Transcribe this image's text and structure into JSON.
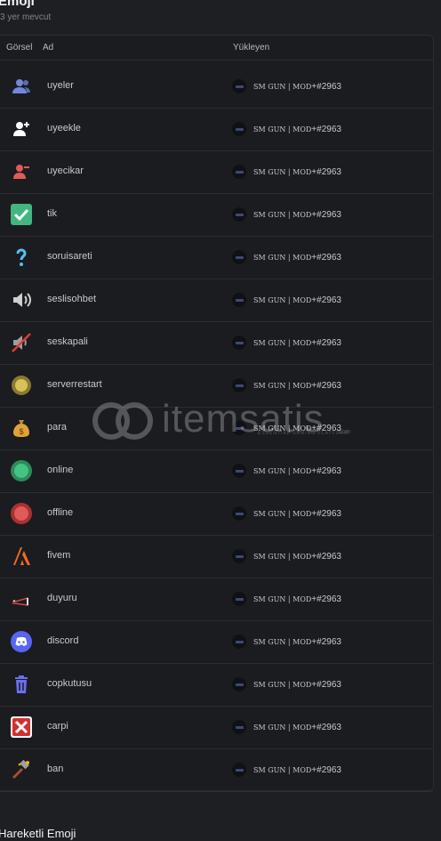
{
  "section": {
    "title": "Emoji",
    "subtitle": "3 yer mevcut"
  },
  "table": {
    "headers": {
      "image": "Görsel",
      "name": "Ad",
      "uploader": "Yükleyen"
    },
    "rows": [
      {
        "name": "uyeler",
        "icon": "users-icon"
      },
      {
        "name": "uyeekle",
        "icon": "user-add-icon"
      },
      {
        "name": "uyecikar",
        "icon": "user-remove-icon"
      },
      {
        "name": "tik",
        "icon": "check-icon"
      },
      {
        "name": "soruisareti",
        "icon": "question-icon"
      },
      {
        "name": "seslisohbet",
        "icon": "speaker-icon"
      },
      {
        "name": "seskapali",
        "icon": "speaker-muted-icon"
      },
      {
        "name": "serverrestart",
        "icon": "yellow-circle-icon"
      },
      {
        "name": "para",
        "icon": "money-bag-icon"
      },
      {
        "name": "online",
        "icon": "green-circle-icon"
      },
      {
        "name": "offline",
        "icon": "red-circle-icon"
      },
      {
        "name": "fivem",
        "icon": "fivem-icon"
      },
      {
        "name": "duyuru",
        "icon": "megaphone-icon"
      },
      {
        "name": "discord",
        "icon": "discord-icon"
      },
      {
        "name": "copkutusu",
        "icon": "trash-icon"
      },
      {
        "name": "carpi",
        "icon": "cross-icon"
      },
      {
        "name": "ban",
        "icon": "ban-hammer-icon"
      }
    ],
    "uploader": {
      "name": "SM GUN | MOD",
      "tag": "+#2963"
    }
  },
  "watermark": {
    "text": "itemsatis",
    "subtext": "ESSENTIAL GAMING PLATFORM",
    "domain": ".com"
  },
  "next_section": {
    "title": "Hareketli Emoji"
  },
  "colors": {
    "background": "#1e1f22",
    "panel": "#1b1c20",
    "border": "#2b2d31",
    "muted_text": "#80848e"
  }
}
